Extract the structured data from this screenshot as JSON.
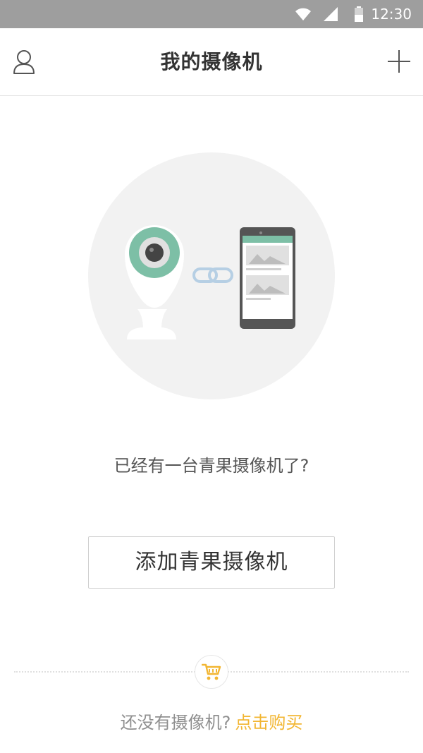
{
  "status_bar": {
    "time": "12:30",
    "icons": [
      "wifi-icon",
      "cell-signal-icon",
      "battery-icon"
    ]
  },
  "header": {
    "title": "我的摄像机",
    "left_icon": "user-icon",
    "right_icon": "plus-icon"
  },
  "hero": {
    "illustration": [
      "camera-icon",
      "link-icon",
      "phone-icon"
    ]
  },
  "prompt": {
    "text": "已经有一台青果摄像机了?"
  },
  "add_button": {
    "label": "添加青果摄像机"
  },
  "buy": {
    "icon": "cart-icon",
    "question": "还没有摄像机?",
    "link_label": "点击购买"
  },
  "colors": {
    "status_bar_bg": "#9e9e9e",
    "camera_lens_ring": "#7dbfa6",
    "phone_screen_header": "#7dbfa6",
    "link_chain": "#b6cfe4",
    "buy_link": "#f2b632",
    "hero_bg": "#f2f2f2"
  }
}
